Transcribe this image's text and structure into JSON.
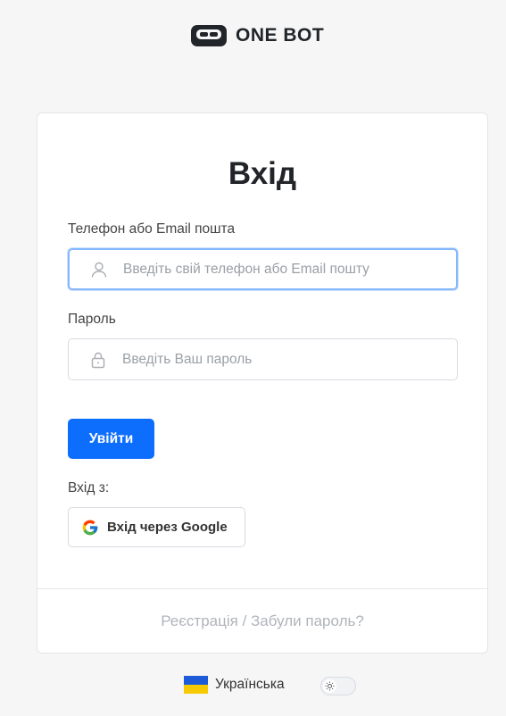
{
  "brand": {
    "name": "ONE BOT"
  },
  "login": {
    "title": "Вхід",
    "login_label": "Телефон або Email пошта",
    "login_placeholder": "Введіть свій телефон або Email пошту",
    "password_label": "Пароль",
    "password_placeholder": "Введіть Ваш пароль",
    "submit_label": "Увійти",
    "social_label": "Вхід з:",
    "google_label": "Вхід через Google",
    "register_link": "Реєстрація",
    "separator": " / ",
    "forgot_link": "Забули пароль?"
  },
  "footer": {
    "language": "Українська",
    "theme_toggle": {
      "state": "light",
      "icon": "sun-icon"
    }
  },
  "colors": {
    "primary": "#0d6efd",
    "background": "#f6f6f7",
    "flag_blue": "#1e5bd6",
    "flag_yellow": "#f7c900"
  }
}
